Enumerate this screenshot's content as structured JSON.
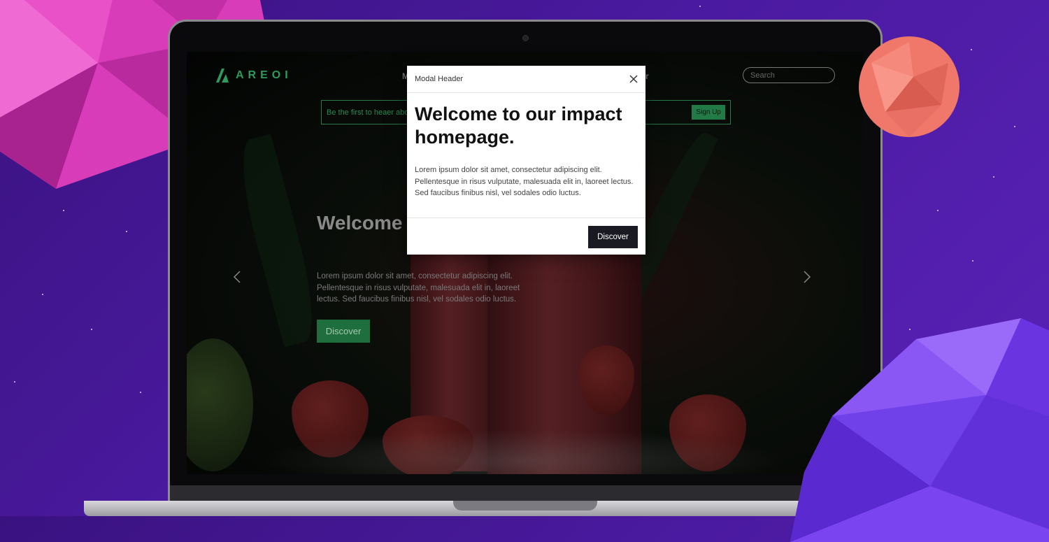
{
  "site": {
    "logo_text": "AREOI",
    "nav_fragments": [
      "M",
      "r"
    ],
    "search": {
      "placeholder": "Search"
    },
    "signup": {
      "text": "Be the first to heaer abo",
      "button": "Sign Up"
    },
    "hero": {
      "title": "Welcome to our impact homepage.",
      "body": "Lorem ipsum dolor sit amet, consectetur adipiscing elit. Pellentesque in risus vulputate, malesuada elit in, laoreet lectus. Sed faucibus finibus nisl, vel sodales odio luctus.",
      "button": "Discover"
    },
    "carousel": {
      "prev_icon": "chevron-left-icon",
      "next_icon": "chevron-right-icon"
    }
  },
  "modal": {
    "header": "Modal Header",
    "title": "Welcome to our impact homepage.",
    "body": "Lorem ipsum dolor sit amet, consectetur adipiscing elit. Pellentesque in risus vulputate, malesuada elit in, laoreet lectus. Sed faucibus finibus nisl, vel sodales odio luctus.",
    "button": "Discover",
    "close_icon": "close-icon"
  },
  "colors": {
    "accent_green": "#2e9a5c",
    "modal_button": "#1a1a22",
    "background_purple": "#4a1aa0"
  }
}
